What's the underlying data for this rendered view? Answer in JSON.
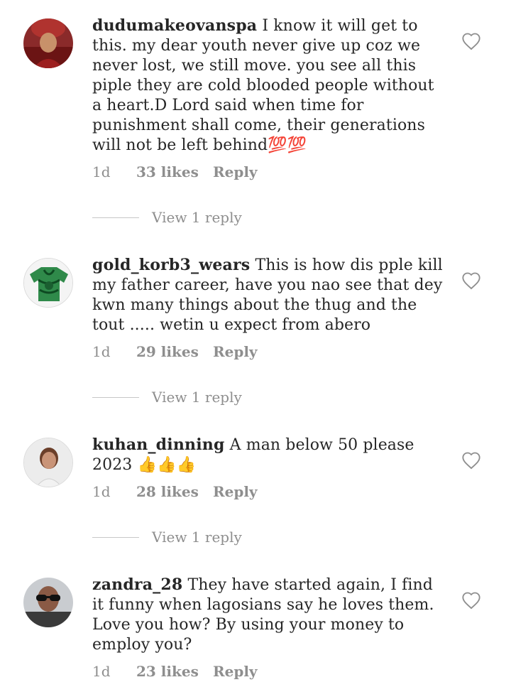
{
  "comments": [
    {
      "username": "dudumakeovanspa",
      "text": "I know it will get to this. my dear youth never give up coz we never lost, we still move. you see all this piple they are cold blooded people without a heart.D Lord said when time for punishment shall come, their generations will not be left behind💯💯",
      "age": "1d",
      "likes": "33 likes",
      "reply": "Reply",
      "view_replies": "View 1 reply"
    },
    {
      "username": "gold_korb3_wears",
      "text": "This is how dis pple kill my father career, have you nao see that dey kwn many things about the thug and the tout ..... wetin u expect from abero",
      "age": "1d",
      "likes": "29 likes",
      "reply": "Reply",
      "view_replies": "View 1 reply"
    },
    {
      "username": "kuhan_dinning",
      "text": "A man below 50 please 2023 👍👍👍",
      "age": "1d",
      "likes": "28 likes",
      "reply": "Reply",
      "view_replies": "View 1 reply"
    },
    {
      "username": "zandra_28",
      "text": "They have started again, I find it funny when lagosians say he loves them. Love you how? By using your money to employ you?",
      "age": "1d",
      "likes": "23 likes",
      "reply": "Reply"
    }
  ],
  "icons": {
    "like": "heart-outline-icon"
  },
  "colors": {
    "text": "#262626",
    "muted": "#8e8e8e",
    "divider": "#c7c7c7"
  }
}
